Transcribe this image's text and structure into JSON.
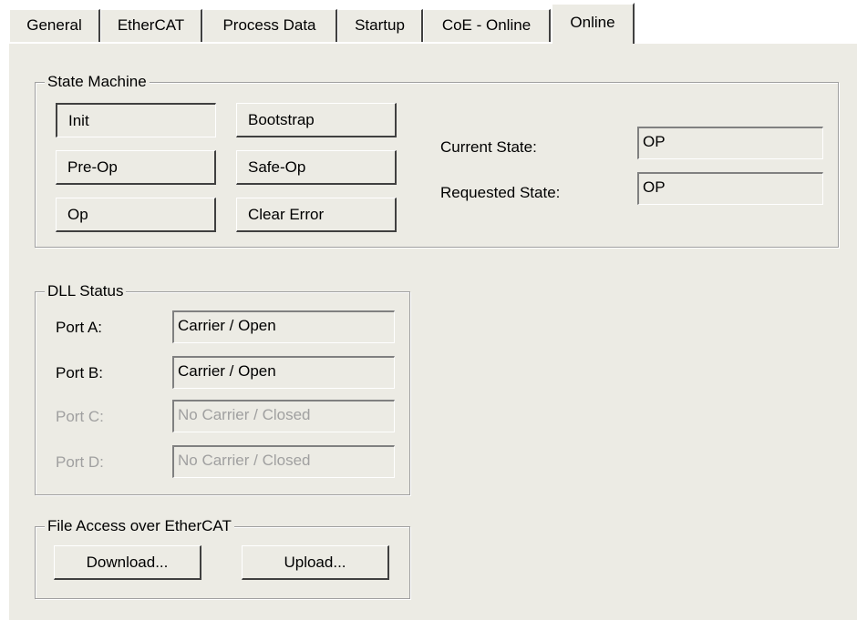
{
  "tabs": [
    {
      "label": "General"
    },
    {
      "label": "EtherCAT"
    },
    {
      "label": "Process Data"
    },
    {
      "label": "Startup"
    },
    {
      "label": "CoE - Online"
    },
    {
      "label": "Online",
      "active": true
    }
  ],
  "state_machine": {
    "title": "State Machine",
    "init": "Init",
    "bootstrap": "Bootstrap",
    "preop": "Pre-Op",
    "safeop": "Safe-Op",
    "op": "Op",
    "clear_error": "Clear Error",
    "current_state_label": "Current State:",
    "current_state_value": "OP",
    "requested_state_label": "Requested State:",
    "requested_state_value": "OP"
  },
  "dll_status": {
    "title": "DLL Status",
    "ports": [
      {
        "label": "Port A:",
        "value": "Carrier / Open",
        "enabled": true
      },
      {
        "label": "Port B:",
        "value": "Carrier / Open",
        "enabled": true
      },
      {
        "label": "Port C:",
        "value": "No Carrier / Closed",
        "enabled": false
      },
      {
        "label": "Port D:",
        "value": "No Carrier / Closed",
        "enabled": false
      }
    ]
  },
  "file_access": {
    "title": "File Access over EtherCAT",
    "download": "Download...",
    "upload": "Upload..."
  }
}
